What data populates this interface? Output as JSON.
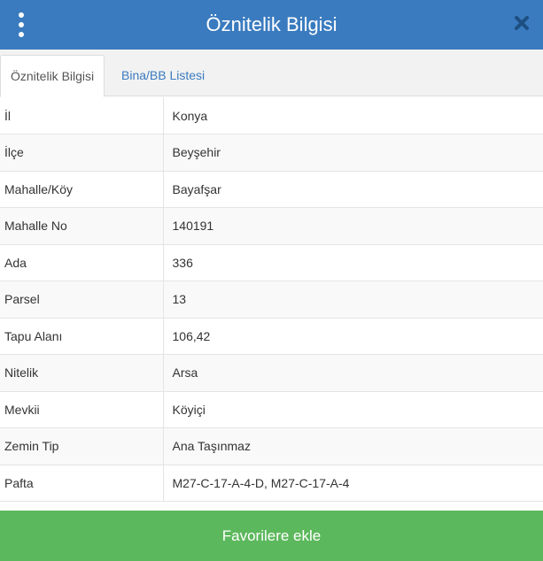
{
  "header": {
    "title": "Öznitelik Bilgisi",
    "menu_icon": "vertical-dots-icon",
    "close_icon": "close-x-icon",
    "color": "#3a7bbf"
  },
  "tabs": [
    {
      "label": "Öznitelik Bilgisi",
      "active": true
    },
    {
      "label": "Bina/BB Listesi",
      "active": false
    }
  ],
  "attributes": [
    {
      "key": "İl",
      "value": "Konya"
    },
    {
      "key": "İlçe",
      "value": "Beyşehir"
    },
    {
      "key": "Mahalle/Köy",
      "value": "Bayafşar"
    },
    {
      "key": "Mahalle No",
      "value": "140191"
    },
    {
      "key": "Ada",
      "value": "336"
    },
    {
      "key": "Parsel",
      "value": "13"
    },
    {
      "key": "Tapu Alanı",
      "value": "106,42"
    },
    {
      "key": "Nitelik",
      "value": "Arsa"
    },
    {
      "key": "Mevkii",
      "value": "Köyiçi"
    },
    {
      "key": "Zemin Tip",
      "value": "Ana Taşınmaz"
    },
    {
      "key": "Pafta",
      "value": "M27-C-17-A-4-D, M27-C-17-A-4"
    }
  ],
  "footer": {
    "favorite_label": "Favorilere ekle",
    "color": "#5cb85c"
  }
}
